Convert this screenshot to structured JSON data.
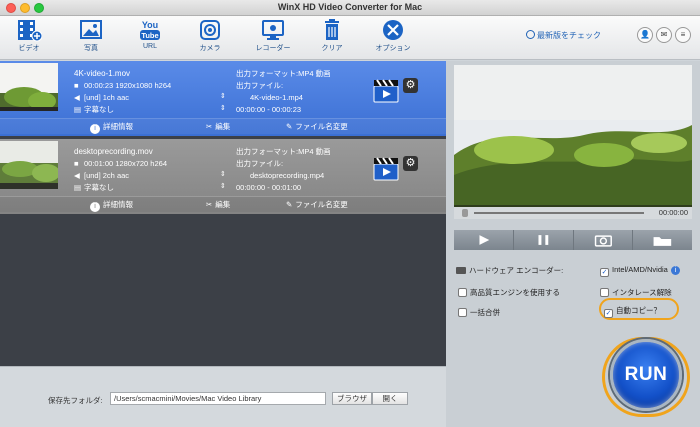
{
  "window": {
    "title": "WinX HD Video Converter for Mac"
  },
  "toolbar": {
    "video_label": "ビデオ",
    "photo_label": "写真",
    "youtube_icon_top": "You",
    "youtube_icon_bottom": "Tube",
    "url_label": "URL",
    "camera_label": "カメラ",
    "recorder_label": "レコーダー",
    "clear_label": "クリア",
    "options_label": "オプション",
    "update_label": "最新版をチェック",
    "user_glyph": "👤",
    "mail_glyph": "✉",
    "menu_glyph": "≡"
  },
  "files": [
    {
      "name": "4K-video-1.mov",
      "duration_info": "00:00:23 1920x1080 h264",
      "audio_info": "[und] 1ch aac",
      "subtitle_info": "字幕なし",
      "output_format": "出力フォーマット:MP4 動画",
      "output_file_label": "出力ファイル:",
      "output_file": "4K-video-1.mp4",
      "range": "00:00:00 - 00:00:23",
      "detail_label": "詳細情報",
      "edit_label": "編集",
      "rename_label": "ファイル名変更"
    },
    {
      "name": "desktoprecording.mov",
      "duration_info": "00:01:00 1280x720 h264",
      "audio_info": "[und] 2ch aac",
      "subtitle_info": "字幕なし",
      "output_format": "出力フォーマット:MP4 動画",
      "output_file_label": "出力ファイル:",
      "output_file": "desktoprecording.mp4",
      "range": "00:00:00 - 00:01:00",
      "detail_label": "詳細情報",
      "edit_label": "編集",
      "rename_label": "ファイル名変更"
    }
  ],
  "bottom": {
    "save_folder_label": "保存先フォルダ:",
    "save_folder_value": "/Users/scmacmini/Movies/Mac Video Library",
    "browse_label": "ブラウザ",
    "open_label": "開く"
  },
  "preview": {
    "time": "00:00:00"
  },
  "options": {
    "hw_encoder_label": "ハードウェア エンコーダー:",
    "intel_label": "Intel/AMD/Nvidia",
    "intel_checked": true,
    "high_quality_label": "高品質エンジンを使用する",
    "high_quality_checked": false,
    "deinterlace_label": "インタレース解除",
    "deinterlace_checked": false,
    "merge_label": "一括合併",
    "merge_checked": false,
    "auto_copy_label": "自動コピー？",
    "auto_copy_checked": true,
    "help_glyph": "i",
    "check_glyph": "✓"
  },
  "run": {
    "label": "RUN"
  },
  "colors": {
    "accent_blue": "#3b6fd3",
    "highlight_orange": "#f0a41c",
    "run_blue": "#1351c9"
  }
}
